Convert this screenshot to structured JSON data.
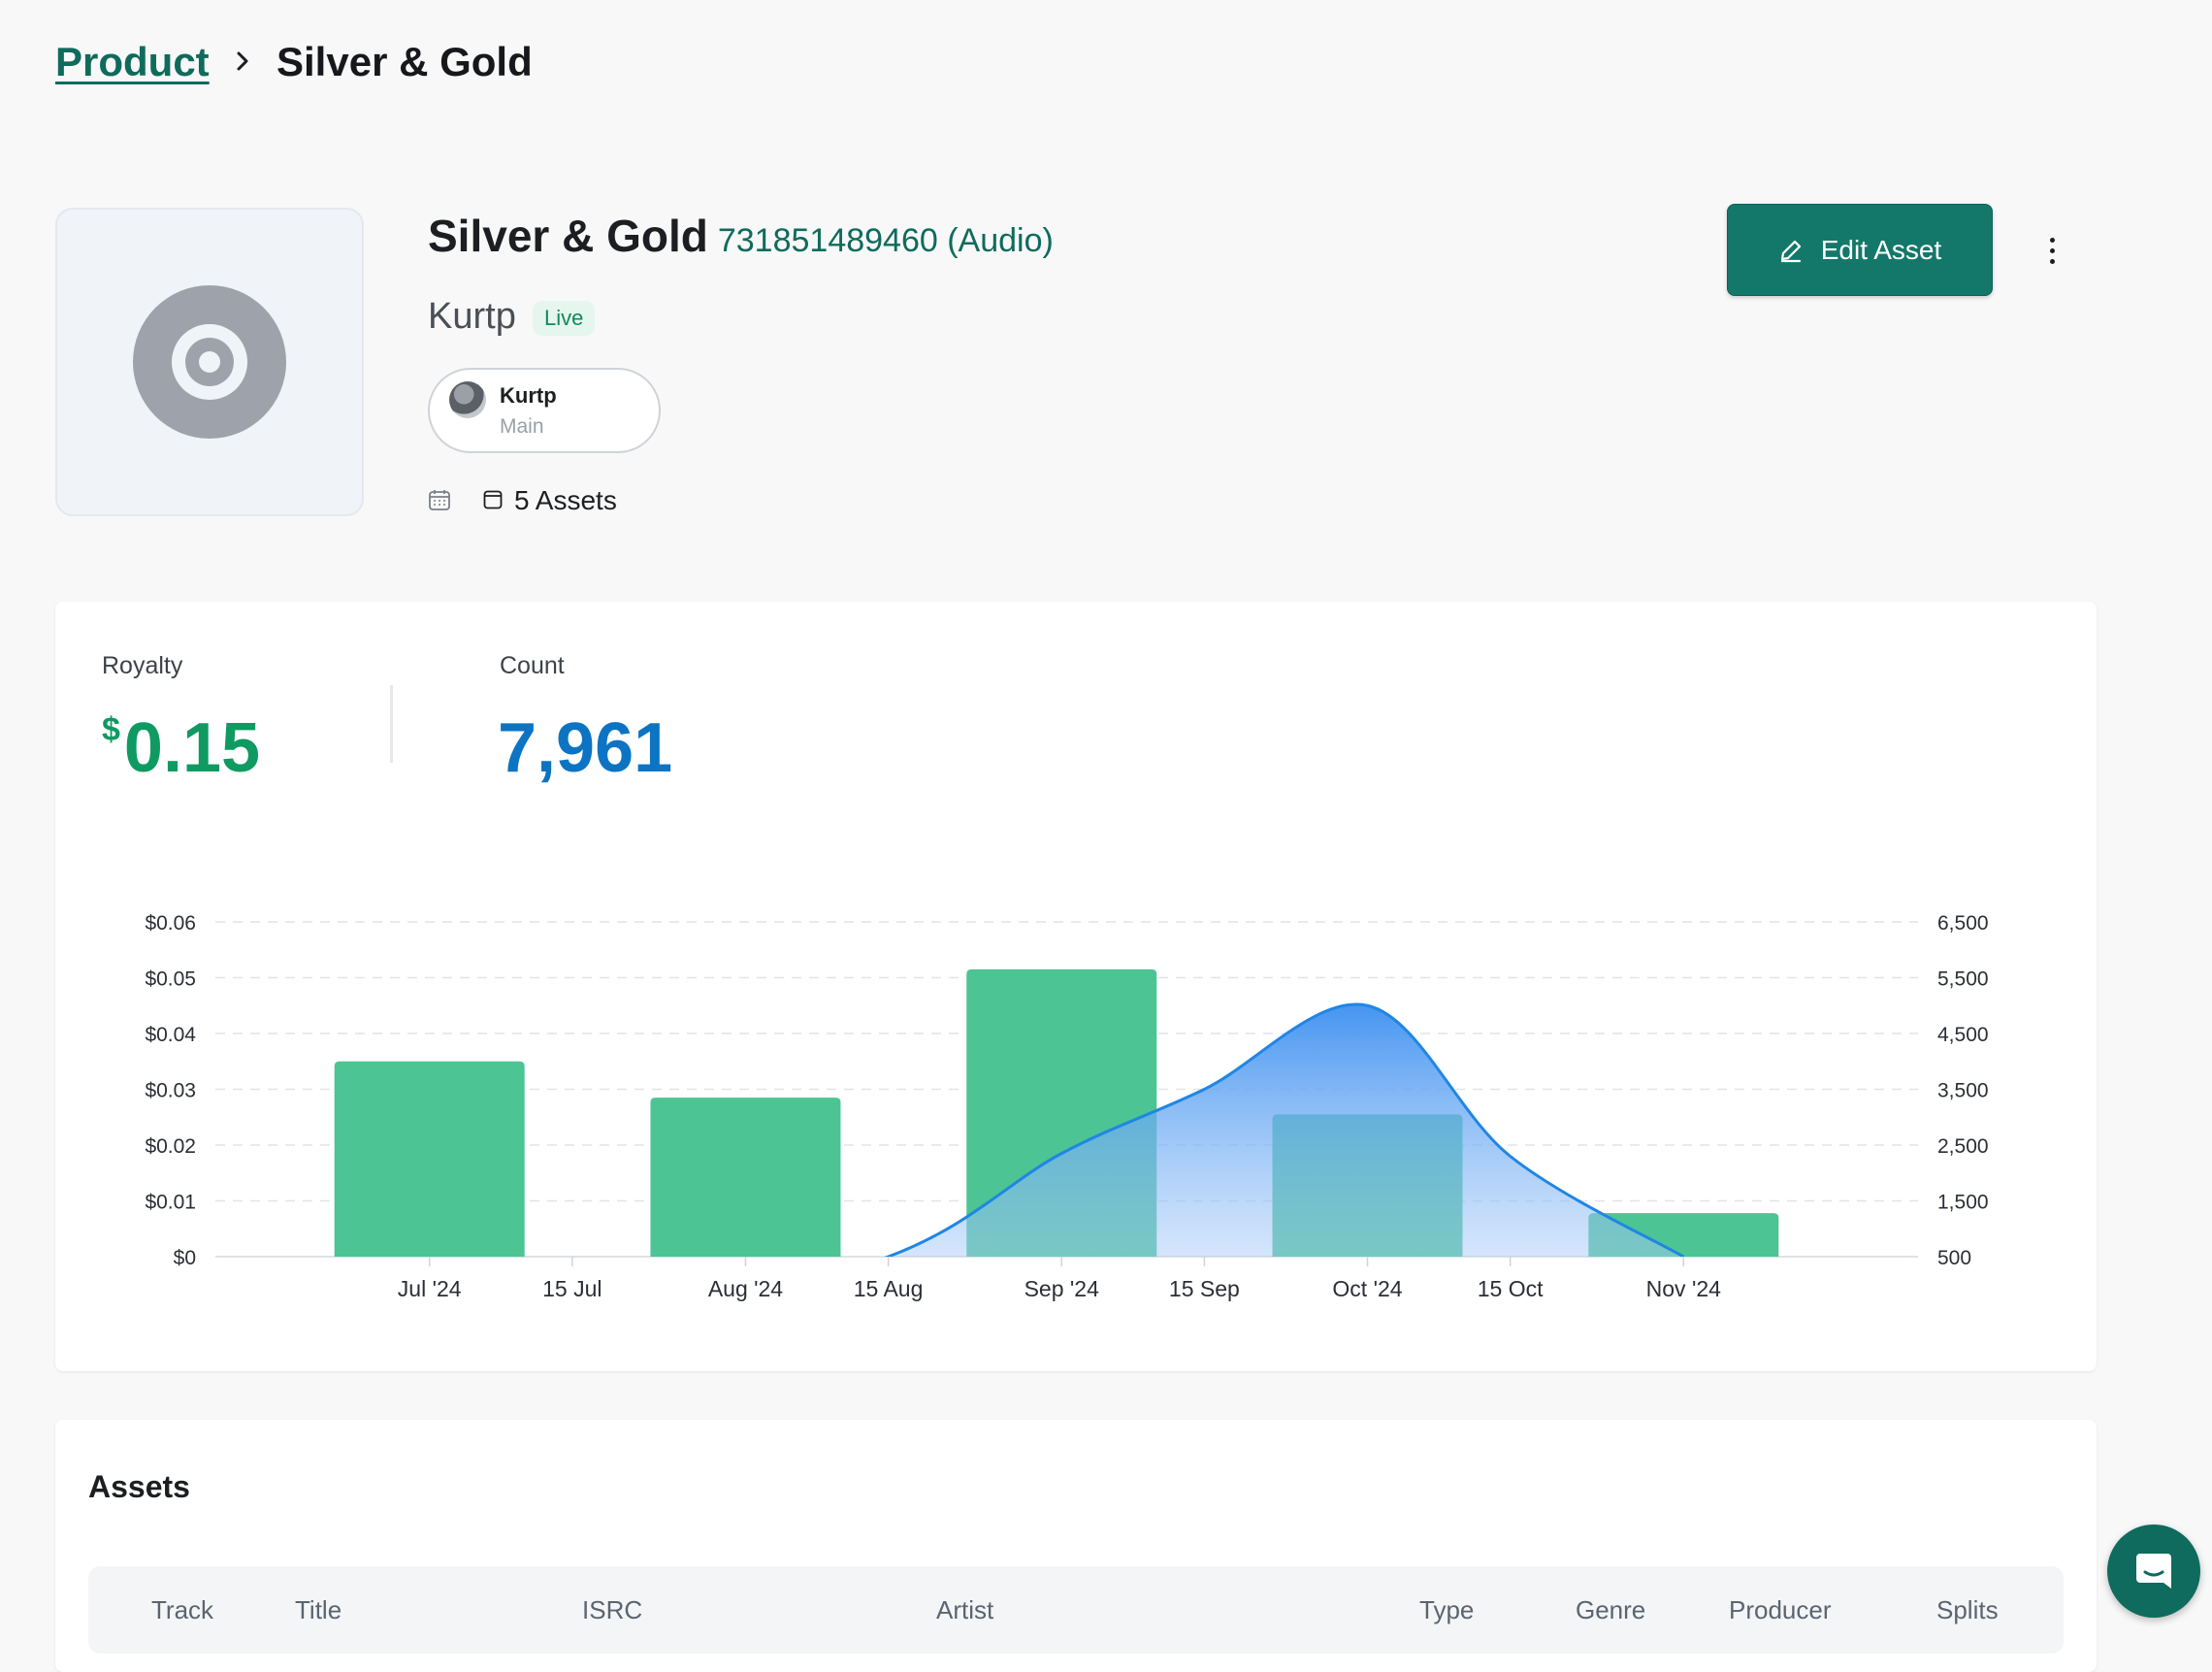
{
  "breadcrumb": {
    "parent": "Product",
    "current": "Silver & Gold"
  },
  "asset": {
    "title": "Silver & Gold",
    "id_text": "731851489460 (Audio)",
    "artist": "Kurtp",
    "status": "Live",
    "chip": {
      "name": "Kurtp",
      "role": "Main"
    },
    "assets_count": "5 Assets"
  },
  "actions": {
    "edit_label": "Edit Asset"
  },
  "stats": {
    "royalty_label": "Royalty",
    "royalty_currency": "$",
    "royalty_value": "0.15",
    "count_label": "Count",
    "count_value": "7,961"
  },
  "colors": {
    "accent": "#13786a",
    "royalty": "#0f9a62",
    "count": "#0c74c2",
    "bar": "#4cc493",
    "line": "#1f86e5"
  },
  "chart_data": {
    "type": "bar",
    "series": [
      {
        "axis": "left",
        "kind": "bar",
        "x": [
          "2024-07-01",
          "2024-08-01",
          "2024-09-01",
          "2024-10-01",
          "2024-11-01"
        ],
        "values": [
          0.035,
          0.0285,
          0.0515,
          0.0255,
          0.0078
        ]
      },
      {
        "axis": "right",
        "kind": "area",
        "x": [
          "2024-07-15",
          "2024-08-15",
          "2024-09-01",
          "2024-09-15",
          "2024-10-01",
          "2024-10-15",
          "2024-11-01"
        ],
        "values": [
          -900,
          500,
          2350,
          3500,
          5000,
          2300,
          500
        ]
      }
    ],
    "x_ticks": [
      "Jul '24",
      "15 Jul",
      "Aug '24",
      "15 Aug",
      "Sep '24",
      "15 Sep",
      "Oct '24",
      "15 Oct",
      "Nov '24"
    ],
    "x_tick_dates": [
      "2024-07-01",
      "2024-07-15",
      "2024-08-01",
      "2024-08-15",
      "2024-09-01",
      "2024-09-15",
      "2024-10-01",
      "2024-10-15",
      "2024-11-01"
    ],
    "y_left_ticks": [
      "$0",
      "$0.01",
      "$0.02",
      "$0.03",
      "$0.04",
      "$0.05",
      "$0.06"
    ],
    "y_left_range": [
      0,
      0.06
    ],
    "y_right_ticks": [
      "500",
      "1,500",
      "2,500",
      "3,500",
      "4,500",
      "5,500",
      "6,500"
    ],
    "y_right_range": [
      500,
      6500
    ],
    "x_range": [
      "2024-06-10",
      "2024-11-24"
    ],
    "grid": true
  },
  "assets_section": {
    "heading": "Assets",
    "columns": [
      "Track",
      "Title",
      "ISRC",
      "Artist",
      "Type",
      "Genre",
      "Producer",
      "Splits"
    ]
  }
}
